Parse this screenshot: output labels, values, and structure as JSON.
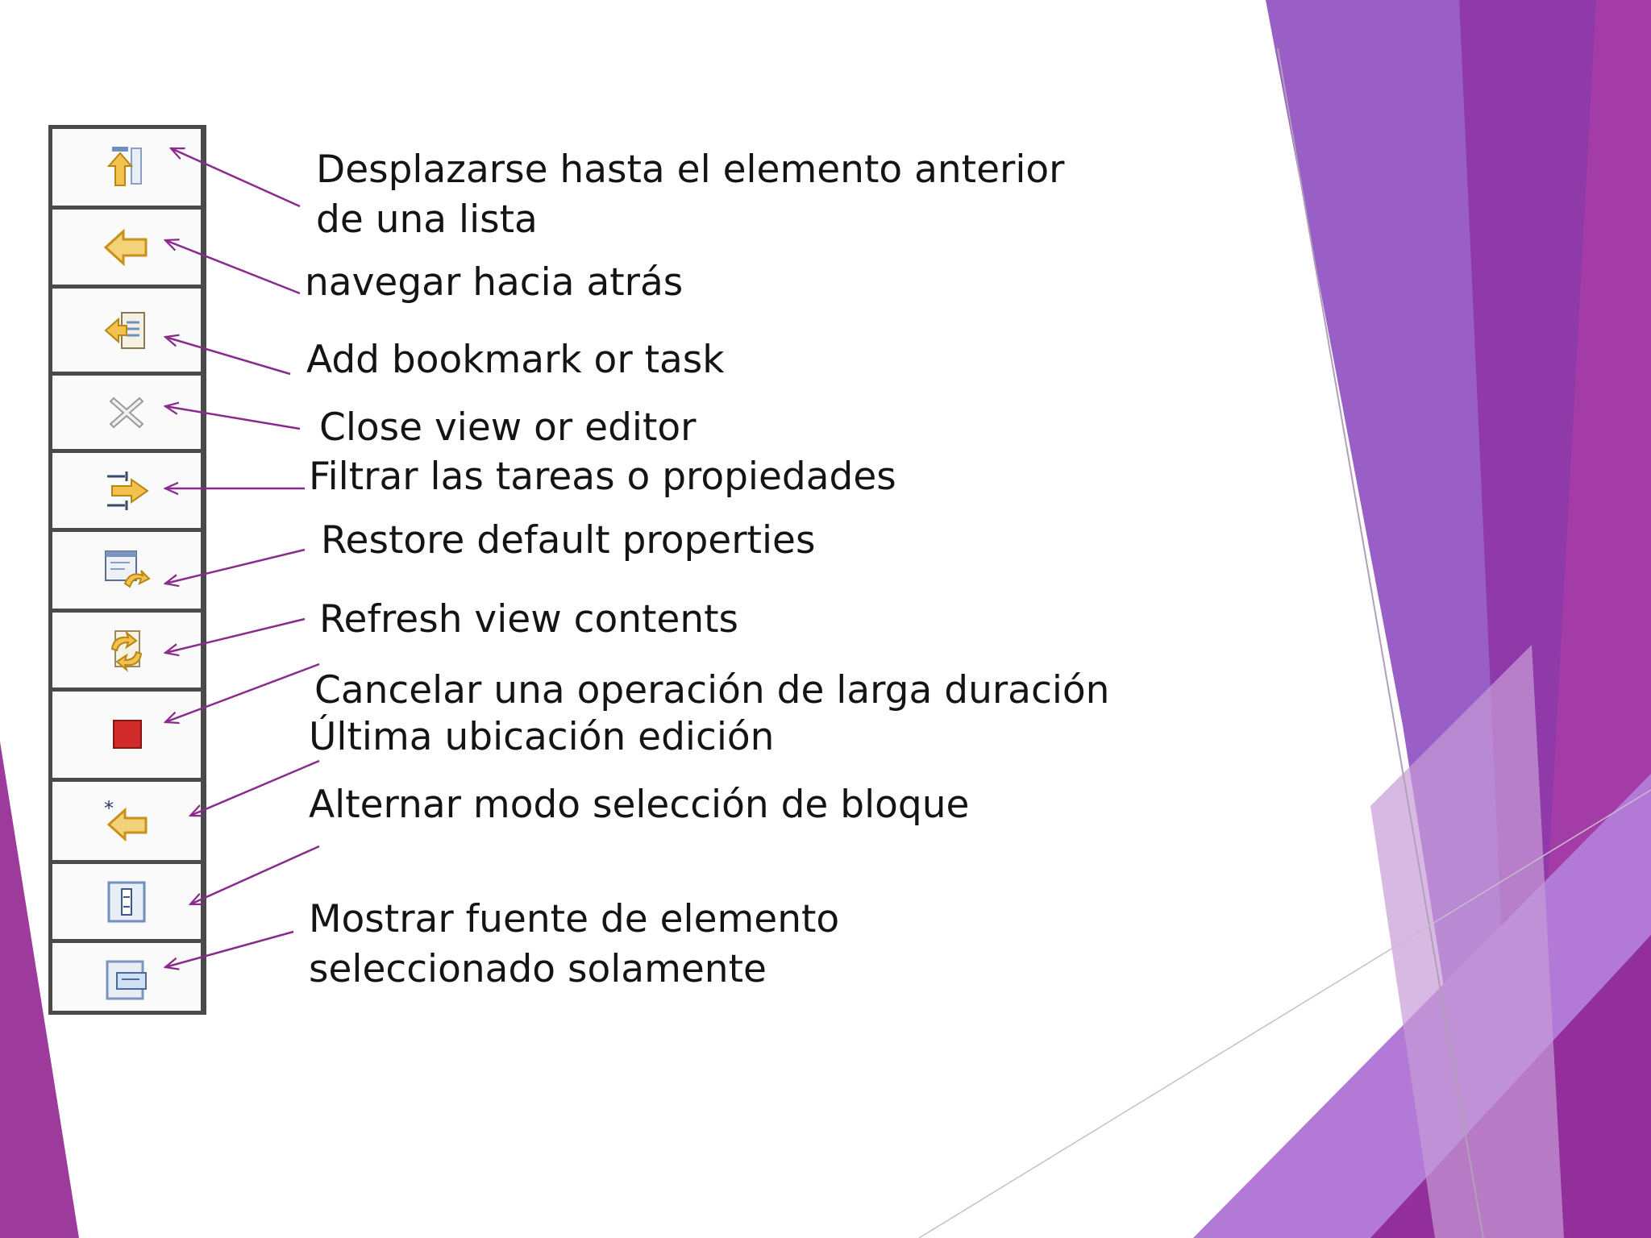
{
  "buttons": [
    {
      "icon": "scroll-up-previous-icon",
      "label": "Desplazarse hasta el elemento anterior de una lista"
    },
    {
      "icon": "back-arrow-icon",
      "label": "navegar hacia atrás"
    },
    {
      "icon": "add-bookmark-icon",
      "label": "Add bookmark or task"
    },
    {
      "icon": "close-x-icon",
      "label": "Close view or editor"
    },
    {
      "icon": "filter-icon",
      "label": "Filtrar las tareas o propiedades"
    },
    {
      "icon": "restore-defaults-icon",
      "label": "Restore default properties"
    },
    {
      "icon": "refresh-icon",
      "label": "Refresh view contents"
    },
    {
      "icon": "stop-icon",
      "label": "Cancelar una operación de larga duración"
    },
    {
      "icon": "last-edit-location-icon",
      "label": "Última ubicación edición"
    },
    {
      "icon": "block-selection-icon",
      "label": "Alternar modo selección de bloque"
    },
    {
      "icon": "show-source-icon",
      "label": "Mostrar fuente de elemento seleccionado solamente"
    }
  ],
  "colors": {
    "arrow": "#8a2a8c",
    "purple_dark": "#7d2b8c",
    "purple_mid": "#9a3bb0",
    "violet": "#8e5cc4",
    "lilac": "#c9a6dc",
    "icon_yellow": "#f2c14e",
    "stop_red": "#d02a2a"
  }
}
